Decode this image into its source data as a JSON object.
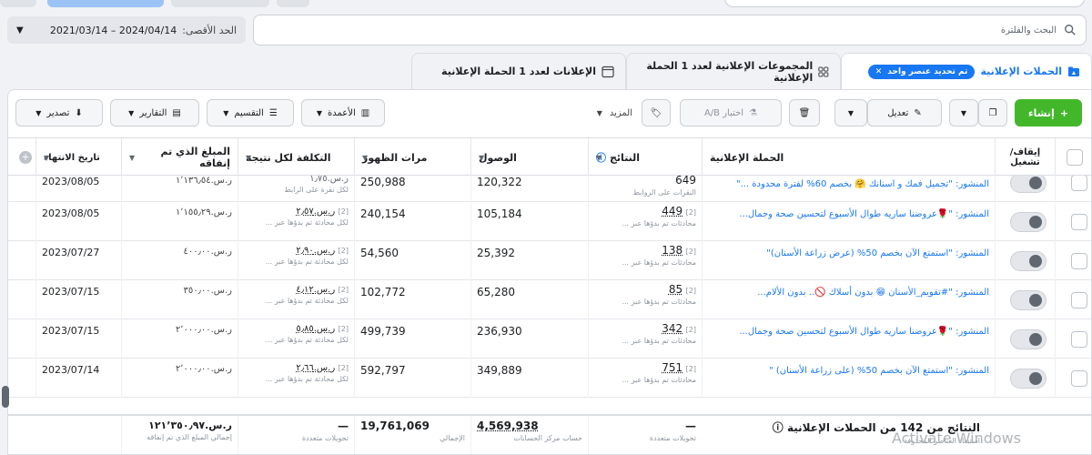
{
  "date_range": {
    "label": "الحد الأقصى:",
    "value": "2021/03/14 – 2024/04/14"
  },
  "search": {
    "placeholder": "البحث والفلترة"
  },
  "tabs": {
    "campaigns": "الحملات الإعلانية",
    "selected_chip": "تم تحديد عنصر واحد",
    "adsets": "المجموعات الإعلانية لعدد 1 الحملة الإعلانية",
    "ads": "الإعلانات لعدد 1 الحملة الإعلانية"
  },
  "toolbar": {
    "create": "إنشاء",
    "edit": "تعديل",
    "ab_test": "اختبار A/B",
    "more": "المزيد",
    "columns": "الأعمدة",
    "breakdown": "التقسيم",
    "reports": "التقارير",
    "export": "تصدير"
  },
  "headers": {
    "toggle": "إيقاف/ تشغيل",
    "campaign": "الحملة الإعلانية",
    "results": "النتائج",
    "reach": "الوصول",
    "impressions": "مرات الظهور",
    "cost_per_result": "التكلفة لكل نتيجة",
    "amount_spent": "المبلغ الذي تم إنفاقه",
    "end_date": "تاريخ الانتهاء"
  },
  "rows": [
    {
      "campaign": "المنشور: \"تجميل فمك و اسنانك 🤗 بخصم 60% لفترة محدودة ...\"",
      "results": "649",
      "results_sub": "النقرات على الروابط",
      "reach": "120,322",
      "impressions": "250,988",
      "cost": "ر.س.١٫٧٥",
      "cost_sub": "لكل نقرة على الرابط",
      "spent": "ر.س.١٬١٣٦٫٥٤",
      "end_date": "2023/08/05"
    },
    {
      "campaign": "المنشور: \"🌹عروضنا ساريه طوال الأسبوع لتحسين صحة وجمال...",
      "results": "449",
      "results_sub": "محادثات تم بدؤها عبر ...",
      "reach": "105,184",
      "impressions": "240,154",
      "cost": "ر.س.٢٫٥٧",
      "cost_sub": "لكل محادثة تم بدؤها عبر ...",
      "spent": "ر.س.١٬١٥٥٫٢٩",
      "end_date": "2023/08/05"
    },
    {
      "campaign": "المنشور: \"استمتع الآن بخصم 50% (عرض زراعة الأسنان)\"",
      "results": "138",
      "results_sub": "محادثات تم بدؤها عبر ...",
      "reach": "25,392",
      "impressions": "54,560",
      "cost": "ر.س.٢٫٩٠",
      "cost_sub": "لكل محادثة تم بدؤها عبر ...",
      "spent": "ر.س.٤٠٠٫٠٠",
      "end_date": "2023/07/27"
    },
    {
      "campaign": "المنشور: \"#تقويم_الأسنان 😁 بدون أسلاك 🚫.. بدون الألام...",
      "results": "85",
      "results_sub": "محادثات تم بدؤها عبر ...",
      "reach": "65,280",
      "impressions": "102,772",
      "cost": "ر.س.٤٫١٢",
      "cost_sub": "لكل محادثة تم بدؤها عبر ...",
      "spent": "ر.س.٣٥٠٫٠٠",
      "end_date": "2023/07/15"
    },
    {
      "campaign": "المنشور: \"🌹عروضنا ساريه طوال الأسبوع لتحسين صحة وجمال...",
      "results": "342",
      "results_sub": "محادثات تم بدؤها عبر ...",
      "reach": "236,930",
      "impressions": "499,739",
      "cost": "ر.س.٥٫٨٥",
      "cost_sub": "لكل محادثة تم بدؤها عبر ...",
      "spent": "ر.س.٢٬٠٠٠٫٠٠",
      "end_date": "2023/07/15"
    },
    {
      "campaign": "المنشور: \"استمتع الآن بخصم 50% (على زراعة الأسنان) \"",
      "results": "751",
      "results_sub": "محادثات تم بدؤها عبر ...",
      "reach": "349,889",
      "impressions": "592,797",
      "cost": "ر.س.٢٫٦٦",
      "cost_sub": "لكل محادثة تم بدؤها عبر ...",
      "spent": "ر.س.٢٬٠٠٠٫٠٠",
      "end_date": "2023/07/14"
    }
  ],
  "footer": {
    "title": "النتائج من 142 من الحملات الإعلانية",
    "title_sub": "استبعاد العناصر المحذوفة",
    "results": "—",
    "results_sub": "تحويلات متعددة",
    "reach": "4,569,938",
    "reach_sub": "حساب مركز الحسابات",
    "impressions": "19,761,069",
    "impressions_sub": "الإجمالي",
    "cost": "—",
    "cost_sub": "تحويلات متعددة",
    "spent": "ر.س.١٢١٬٣٥٠٫٩٧",
    "spent_sub": "إجمالي المبلغ الذي تم إنفاقه"
  },
  "watermark": "Activate Windows",
  "icons": {
    "search": "search-icon",
    "campaign": "campaign-folder-icon",
    "adsets": "adsets-grid-icon",
    "ads": "ad-window-icon"
  }
}
